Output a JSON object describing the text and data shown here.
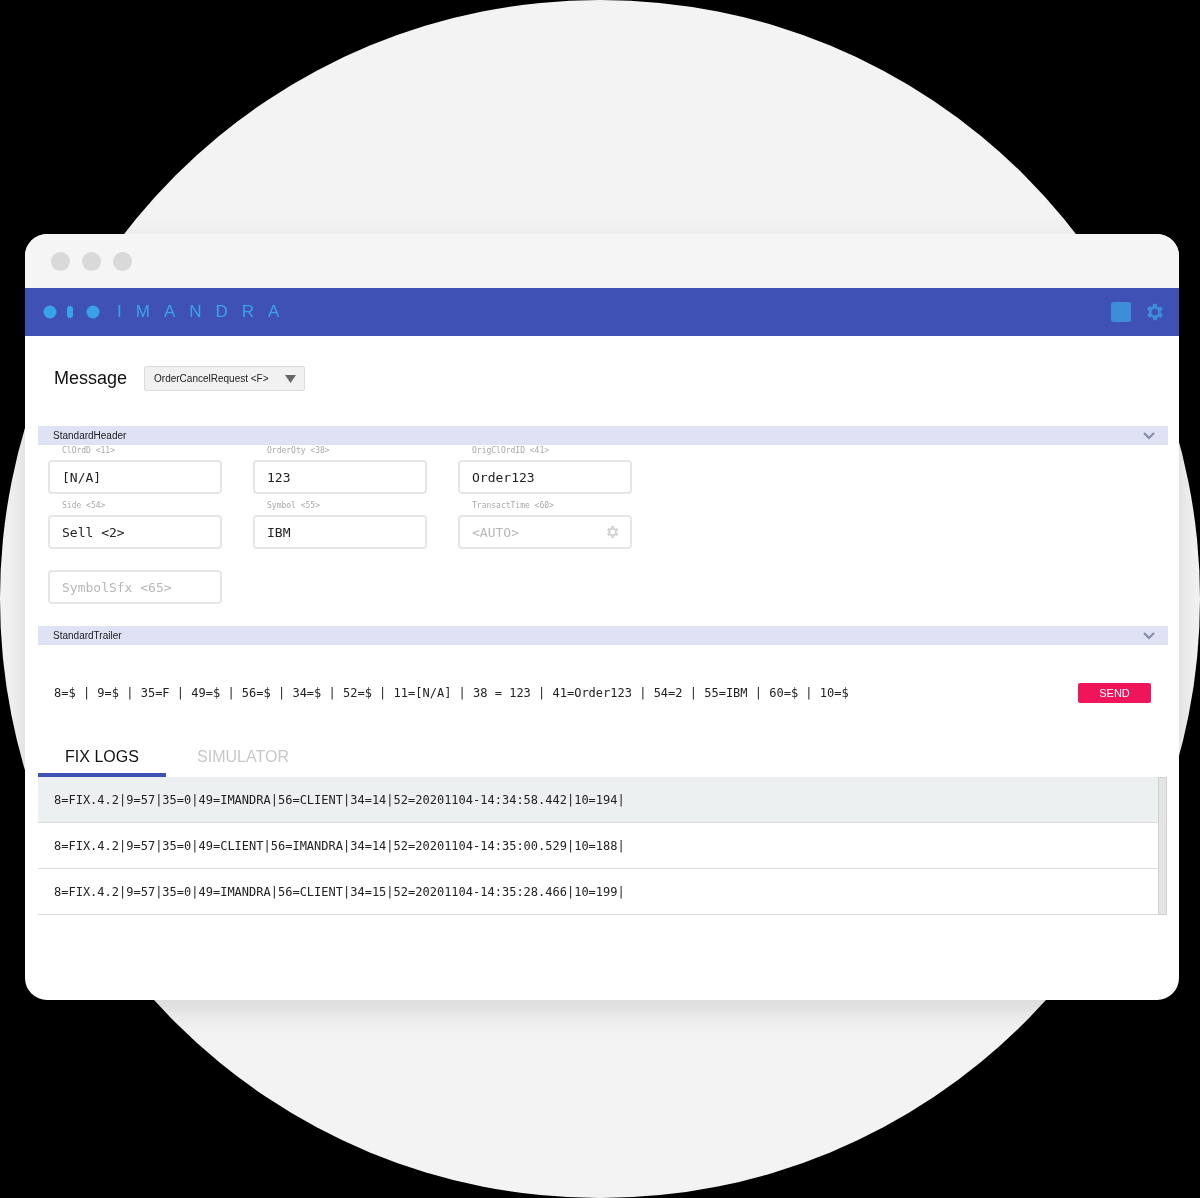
{
  "brand": "IMANDRA",
  "message": {
    "label": "Message",
    "value": "OrderCancelRequest <F>"
  },
  "sections": [
    {
      "title": "StandardHeader",
      "fields": [
        {
          "label": "ClOrdD <11>",
          "value": "[N/A]",
          "kind": "text"
        },
        {
          "label": "OrderQty <38>",
          "value": "123",
          "kind": "text"
        },
        {
          "label": "OrigClOrdID <41>",
          "value": "Order123",
          "kind": "text"
        },
        {
          "label": "Side <54>",
          "value": "Sell <2>",
          "kind": "text"
        },
        {
          "label": "Symbol <55>",
          "value": "IBM",
          "kind": "text"
        },
        {
          "label": "TransactTime <60>",
          "placeholder": "<AUTO>",
          "kind": "auto"
        },
        {
          "placeholder": "SymbolSfx <65>",
          "kind": "text"
        }
      ]
    },
    {
      "title": "StandardTrailer"
    }
  ],
  "fix_string": "8=$ | 9=$ | 35=F | 49=$ | 56=$ | 34=$ | 52=$ | 11=[N/A] | 38 = 123 | 41=Order123 | 54=2 | 55=IBM | 60=$ | 10=$",
  "send_button": "SEND",
  "tabs": [
    {
      "label": "FIX LOGS",
      "selected": true
    },
    {
      "label": "SIMULATOR",
      "selected": false
    }
  ],
  "logs": [
    {
      "text": "8=FIX.4.2|9=57|35=0|49=IMANDRA|56=CLIENT|34=14|52=20201104-14:34:58.442|10=194|",
      "selected": true
    },
    {
      "text": "8=FIX.4.2|9=57|35=0|49=CLIENT|56=IMANDRA|34=14|52=20201104-14:35:00.529|10=188|",
      "selected": false
    },
    {
      "text": "8=FIX.4.2|9=57|35=0|49=IMANDRA|56=CLIENT|34=15|52=20201104-14:35:28.466|10=199|",
      "selected": false
    }
  ]
}
